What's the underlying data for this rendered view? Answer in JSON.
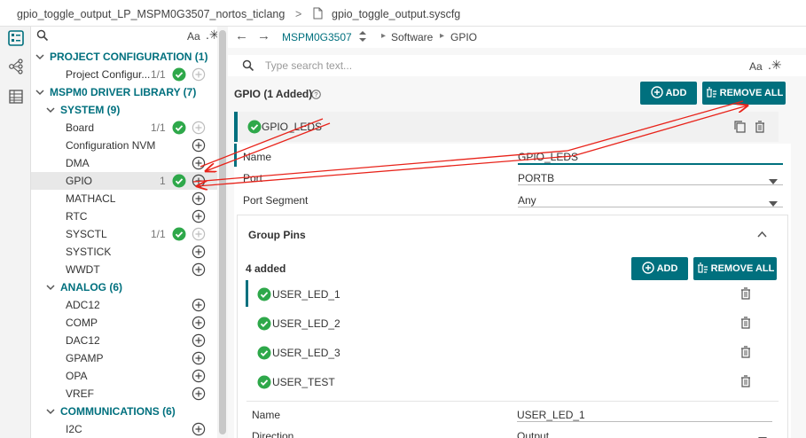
{
  "breadcrumb": {
    "project": "gpio_toggle_output_LP_MSPM0G3507_nortos_ticlang",
    "separator": ">",
    "file": "gpio_toggle_output.syscfg"
  },
  "tree": {
    "case_label": "Aa",
    "items": [
      {
        "label": "PROJECT CONFIGURATION (1)",
        "type": "header",
        "level": 0
      },
      {
        "label": "Project Configur...",
        "type": "item",
        "count": "1/1",
        "status": "check",
        "add": "disabled"
      },
      {
        "label": "MSPM0 DRIVER LIBRARY (7)",
        "type": "header",
        "level": 0
      },
      {
        "label": "SYSTEM (9)",
        "type": "header",
        "level": 1
      },
      {
        "label": "Board",
        "type": "item",
        "count": "1/1",
        "status": "check",
        "add": "disabled"
      },
      {
        "label": "Configuration NVM",
        "type": "item",
        "count": "",
        "status": "",
        "add": "enabled"
      },
      {
        "label": "DMA",
        "type": "item",
        "count": "",
        "status": "",
        "add": "enabled"
      },
      {
        "label": "GPIO",
        "type": "item",
        "count": "1",
        "status": "check",
        "add": "enabled",
        "selected": true
      },
      {
        "label": "MATHACL",
        "type": "item",
        "count": "",
        "status": "",
        "add": "enabled"
      },
      {
        "label": "RTC",
        "type": "item",
        "count": "",
        "status": "",
        "add": "enabled"
      },
      {
        "label": "SYSCTL",
        "type": "item",
        "count": "1/1",
        "status": "check",
        "add": "disabled"
      },
      {
        "label": "SYSTICK",
        "type": "item",
        "count": "",
        "status": "",
        "add": "enabled"
      },
      {
        "label": "WWDT",
        "type": "item",
        "count": "",
        "status": "",
        "add": "enabled"
      },
      {
        "label": "ANALOG (6)",
        "type": "header",
        "level": 1
      },
      {
        "label": "ADC12",
        "type": "item",
        "count": "",
        "status": "",
        "add": "enabled"
      },
      {
        "label": "COMP",
        "type": "item",
        "count": "",
        "status": "",
        "add": "enabled"
      },
      {
        "label": "DAC12",
        "type": "item",
        "count": "",
        "status": "",
        "add": "enabled"
      },
      {
        "label": "GPAMP",
        "type": "item",
        "count": "",
        "status": "",
        "add": "enabled"
      },
      {
        "label": "OPA",
        "type": "item",
        "count": "",
        "status": "",
        "add": "enabled"
      },
      {
        "label": "VREF",
        "type": "item",
        "count": "",
        "status": "",
        "add": "enabled"
      },
      {
        "label": "COMMUNICATIONS (6)",
        "type": "header",
        "level": 1
      },
      {
        "label": "I2C",
        "type": "item",
        "count": "",
        "status": "",
        "add": "enabled"
      }
    ]
  },
  "nav": {
    "device": "MSPM0G3507",
    "path_1": "Software",
    "path_2": "GPIO"
  },
  "search": {
    "placeholder": "Type search text...",
    "case_label": "Aa"
  },
  "gpio": {
    "title": "GPIO (1 Added)",
    "add_label": "ADD",
    "remove_all_label": "REMOVE ALL",
    "instance_name": "GPIO_LEDS",
    "fields": [
      {
        "label": "Name",
        "value": "GPIO_LEDS",
        "kind": "text"
      },
      {
        "label": "Port",
        "value": "PORTB",
        "kind": "select"
      },
      {
        "label": "Port Segment",
        "value": "Any",
        "kind": "select"
      }
    ]
  },
  "group_pins": {
    "title": "Group Pins",
    "added": "4 added",
    "add_label": "ADD",
    "remove_all_label": "REMOVE ALL",
    "pins": [
      "USER_LED_1",
      "USER_LED_2",
      "USER_LED_3",
      "USER_TEST"
    ],
    "fields": [
      {
        "label": "Name",
        "value": "USER_LED_1",
        "kind": "text"
      },
      {
        "label": "Direction",
        "value": "Output",
        "kind": "select"
      }
    ]
  },
  "colors": {
    "accent": "#00707e",
    "check": "#2ea84a",
    "annotation": "#e8231a"
  }
}
